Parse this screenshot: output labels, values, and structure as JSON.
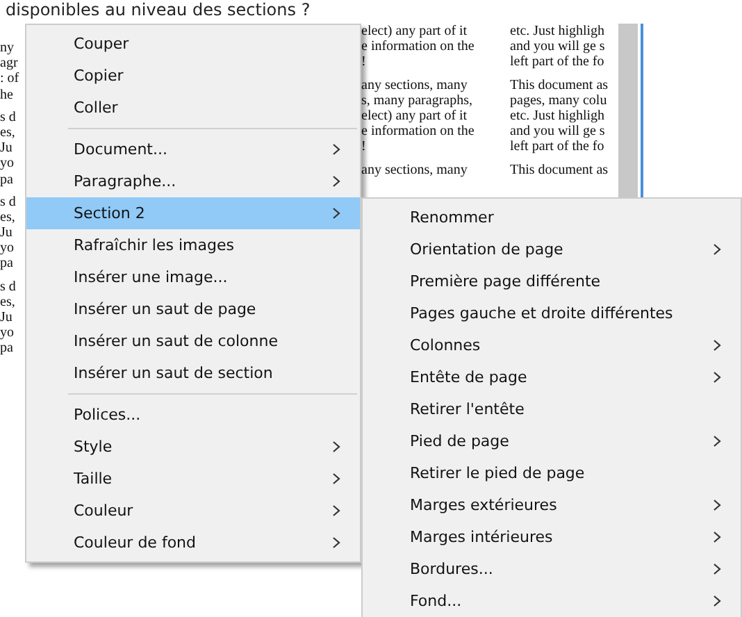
{
  "heading": "disponibles au niveau des sections ?",
  "document": {
    "columns": [
      {
        "paragraphs": [
          [
            "ny",
            "agr",
            ": of",
            "he"
          ],
          [
            "s d",
            "es,",
            "Ju",
            "yo",
            "pa"
          ],
          [
            "s d",
            "es,",
            "Ju",
            "yo",
            "pa"
          ],
          [
            "s d",
            "es,",
            "Ju",
            "yo",
            "pa"
          ]
        ]
      },
      {
        "paragraphs": [
          [
            "elect) any part of it",
            "e information on the",
            "!"
          ],
          [
            "any sections, many",
            "s, many paragraphs,",
            "elect) any part of it",
            "e information on the",
            "!"
          ],
          [
            "any sections, many"
          ]
        ]
      },
      {
        "paragraphs": [
          [
            "etc. Just highligh",
            "and you will ge s",
            "left part of the fo"
          ],
          [
            "This document as",
            "pages, many colu",
            "etc. Just highligh",
            "and you will ge s",
            "left part of the fo"
          ],
          [
            "This document as"
          ]
        ]
      }
    ]
  },
  "context_menu": {
    "items": [
      {
        "kind": "item",
        "label": "Couper",
        "submenu": false,
        "selected": false
      },
      {
        "kind": "item",
        "label": "Copier",
        "submenu": false,
        "selected": false
      },
      {
        "kind": "item",
        "label": "Coller",
        "submenu": false,
        "selected": false
      },
      {
        "kind": "separator"
      },
      {
        "kind": "item",
        "label": "Document...",
        "submenu": true,
        "selected": false
      },
      {
        "kind": "item",
        "label": "Paragraphe...",
        "submenu": true,
        "selected": false
      },
      {
        "kind": "item",
        "label": "Section 2",
        "submenu": true,
        "selected": true
      },
      {
        "kind": "item",
        "label": "Rafraîchir les images",
        "submenu": false,
        "selected": false
      },
      {
        "kind": "item",
        "label": "Insérer une image...",
        "submenu": false,
        "selected": false
      },
      {
        "kind": "item",
        "label": "Insérer un saut de page",
        "submenu": false,
        "selected": false
      },
      {
        "kind": "item",
        "label": "Insérer un saut de colonne",
        "submenu": false,
        "selected": false
      },
      {
        "kind": "item",
        "label": "Insérer un saut de section",
        "submenu": false,
        "selected": false
      },
      {
        "kind": "separator"
      },
      {
        "kind": "item",
        "label": "Polices...",
        "submenu": false,
        "selected": false
      },
      {
        "kind": "item",
        "label": "Style",
        "submenu": true,
        "selected": false
      },
      {
        "kind": "item",
        "label": "Taille",
        "submenu": true,
        "selected": false
      },
      {
        "kind": "item",
        "label": "Couleur",
        "submenu": true,
        "selected": false
      },
      {
        "kind": "item",
        "label": "Couleur de fond",
        "submenu": true,
        "selected": false
      }
    ]
  },
  "submenu": {
    "items": [
      {
        "kind": "item",
        "label": "Renommer",
        "submenu": false,
        "selected": false
      },
      {
        "kind": "item",
        "label": "Orientation de page",
        "submenu": true,
        "selected": false
      },
      {
        "kind": "item",
        "label": "Première page différente",
        "submenu": false,
        "selected": false
      },
      {
        "kind": "item",
        "label": "Pages gauche et droite différentes",
        "submenu": false,
        "selected": false
      },
      {
        "kind": "item",
        "label": "Colonnes",
        "submenu": true,
        "selected": false
      },
      {
        "kind": "item",
        "label": "Entête de page",
        "submenu": true,
        "selected": false
      },
      {
        "kind": "item",
        "label": "Retirer l'entête",
        "submenu": false,
        "selected": false
      },
      {
        "kind": "item",
        "label": "Pied de page",
        "submenu": true,
        "selected": false
      },
      {
        "kind": "item",
        "label": "Retirer le pied de page",
        "submenu": false,
        "selected": false
      },
      {
        "kind": "item",
        "label": "Marges extérieures",
        "submenu": true,
        "selected": false
      },
      {
        "kind": "item",
        "label": "Marges intérieures",
        "submenu": true,
        "selected": false
      },
      {
        "kind": "item",
        "label": "Bordures...",
        "submenu": true,
        "selected": false
      },
      {
        "kind": "item",
        "label": "Fond...",
        "submenu": true,
        "selected": false
      }
    ]
  }
}
